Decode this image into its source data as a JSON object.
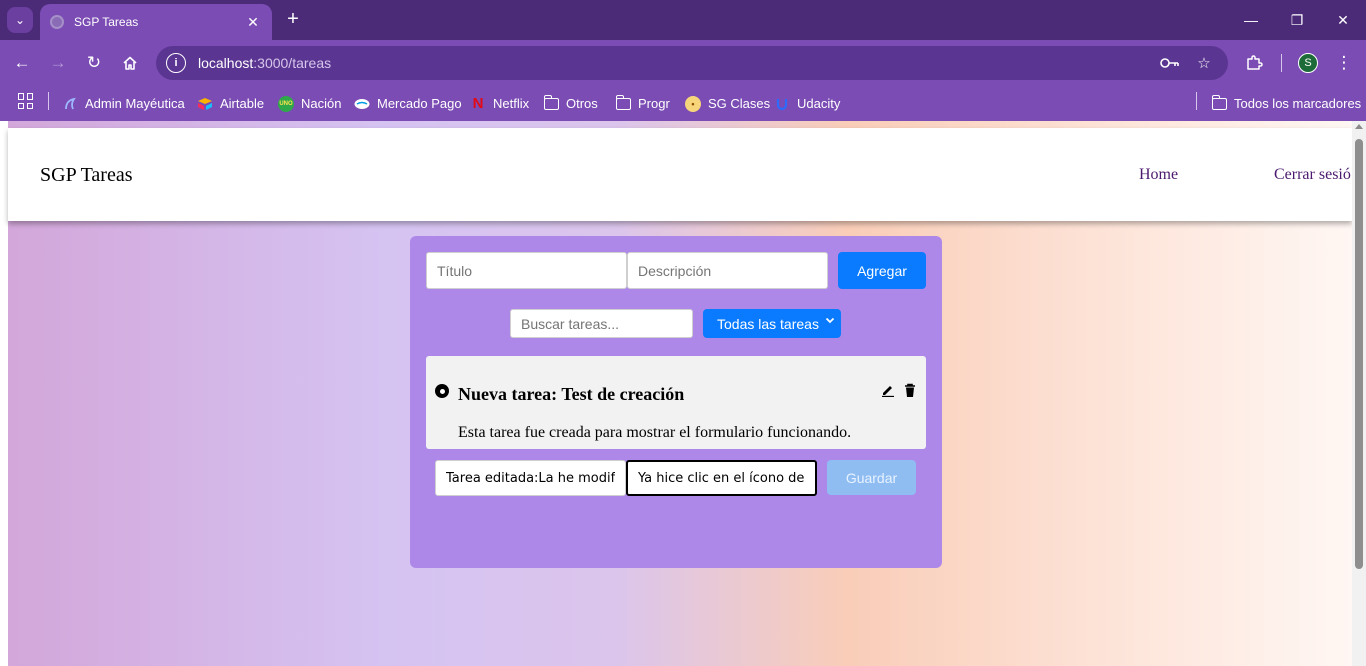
{
  "browser": {
    "tab_title": "SGP Tareas",
    "url_host": "localhost",
    "url_rest": ":3000/tareas",
    "profile_initial": "S",
    "icons": [
      "tab-search-icon",
      "close-icon",
      "plus-icon",
      "minimize-icon",
      "restore-icon",
      "close-window-icon",
      "back-icon",
      "forward-icon",
      "reload-icon",
      "home-icon",
      "site-info-icon",
      "password-key-icon",
      "star-icon",
      "extensions-icon",
      "menu-icon"
    ]
  },
  "bookmarks": {
    "items": [
      {
        "label": "Admin Mayéutica"
      },
      {
        "label": "Airtable"
      },
      {
        "label": "Nación"
      },
      {
        "label": "Mercado Pago"
      },
      {
        "label": "Netflix"
      },
      {
        "label": "Otros"
      },
      {
        "label": "Progr"
      },
      {
        "label": "SG Clases"
      },
      {
        "label": "Udacity"
      }
    ],
    "all_label": "Todos los marcadores"
  },
  "navbar": {
    "brand": "SGP Tareas",
    "links": [
      {
        "label": "Home"
      },
      {
        "label": "Cerrar sesió"
      }
    ]
  },
  "form": {
    "title_placeholder": "Título",
    "description_placeholder": "Descripción",
    "add_label": "Agregar",
    "search_placeholder": "Buscar tareas...",
    "filter_selected": "Todas las tareas"
  },
  "task": {
    "title": "Nueva tarea: Test de creación",
    "description": "Esta tarea fue creada para mostrar el formulario funcionando.",
    "edit_title_value": "Tarea editada:La he modifica",
    "edit_description_value": "Ya hice clic en el ícono de lá",
    "save_label": "Guardar"
  },
  "colors": {
    "chrome_tabstrip": "#4b2a78",
    "chrome_toolbar": "#7b4cb3",
    "panel": "#ae88e8",
    "primary_button": "#0a7bff",
    "save_button_disabled": "#8fbdf2",
    "nav_link": "#4b1a6e"
  }
}
